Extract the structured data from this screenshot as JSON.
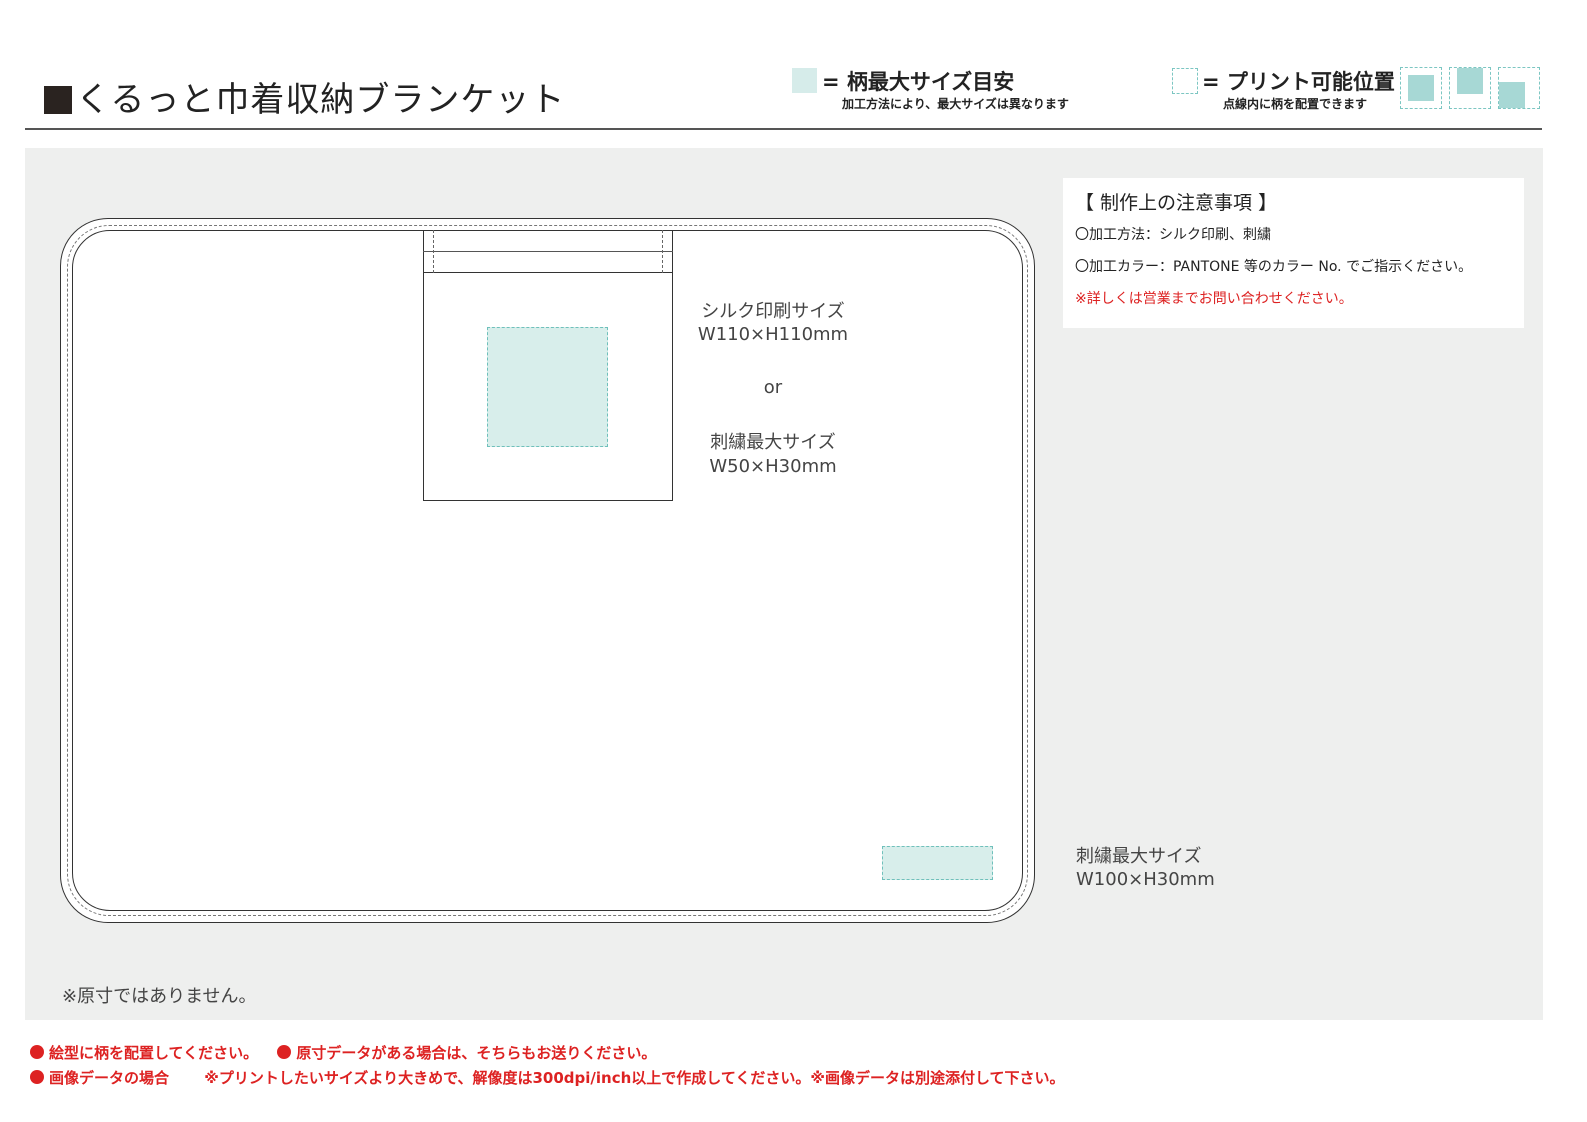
{
  "header": {
    "title": "くるっと巾着収納ブランケット"
  },
  "legend": {
    "max_size": {
      "label": "= 柄最大サイズ目安",
      "note": "加工方法により、最大サイズは異なります",
      "color": "#d6ecea"
    },
    "print_position": {
      "label": "= プリント可能位置",
      "note": "点線内に柄を配置できます",
      "color": "#a7d8d5"
    }
  },
  "notes": {
    "title": "【 制作上の注意事項 】",
    "lines": [
      "〇加工方法：シルク印刷、刺繍",
      "〇加工カラー：PANTONE 等のカラー No. でご指示ください。"
    ],
    "warning": "※詳しくは営業までお問い合わせください。"
  },
  "pocket_area": {
    "silk_label": "シルク印刷サイズ",
    "silk_size": "W110×H110mm",
    "or": "or",
    "emb_label": "刺繍最大サイズ",
    "emb_size": "W50×H30mm"
  },
  "corner_area": {
    "emb_label": "刺繍最大サイズ",
    "emb_size": "W100×H30mm"
  },
  "canvas_note": "※原寸ではありません。",
  "footer": {
    "row1_a": "絵型に柄を配置してください。",
    "row1_b": "原寸データがある場合は、そちらもお送りください。",
    "row2_a": "画像データの場合",
    "row2_b": "※プリントしたいサイズより大きめで、解像度は300dpi/inch以上で作成してください。※画像データは別途添付して下さい。"
  }
}
